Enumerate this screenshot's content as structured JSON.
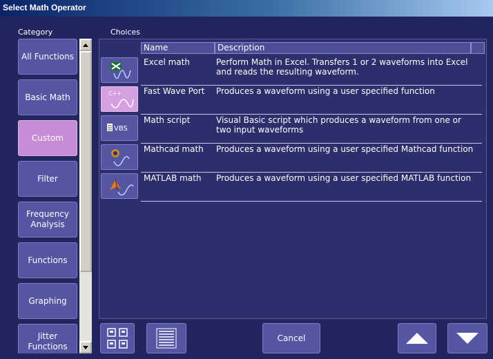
{
  "window": {
    "title": "Select Math Operator"
  },
  "headers": {
    "category": "Category",
    "choices": "Choices"
  },
  "categories": [
    {
      "label": "All Functions",
      "active": false
    },
    {
      "label": "Basic Math",
      "active": false
    },
    {
      "label": "Custom",
      "active": true
    },
    {
      "label": "Filter",
      "active": false
    },
    {
      "label": "Frequency Analysis",
      "active": false
    },
    {
      "label": "Functions",
      "active": false
    },
    {
      "label": "Graphing",
      "active": false
    },
    {
      "label": "Jitter Functions",
      "active": false
    }
  ],
  "table": {
    "columns": [
      "Name",
      "Description"
    ],
    "rows": [
      {
        "icon": "excel-waveform-icon",
        "icon_text": "",
        "name": "Excel math",
        "description": "Perform Math in Excel. Transfers 1 or 2 waveforms into Excel and reads the resulting waveform."
      },
      {
        "icon": "cpp-waveform-icon",
        "icon_text": "C++",
        "name": "Fast Wave Port",
        "description": "Produces a waveform using a user specified function"
      },
      {
        "icon": "vbs-script-icon",
        "icon_text": "VBS",
        "name": "Math script",
        "description": "Visual Basic script which produces a waveform from one or two input waveforms"
      },
      {
        "icon": "mathcad-waveform-icon",
        "icon_text": "",
        "name": "Mathcad math",
        "description": "Produces a waveform using a user specified Mathcad function"
      },
      {
        "icon": "matlab-waveform-icon",
        "icon_text": "",
        "name": "MATLAB math",
        "description": "Produces a waveform using a user specified MATLAB function"
      }
    ]
  },
  "buttons": {
    "cancel": "Cancel"
  },
  "colors": {
    "background": "#23255e",
    "button": "#5455a3",
    "active": "#c88bd6"
  }
}
